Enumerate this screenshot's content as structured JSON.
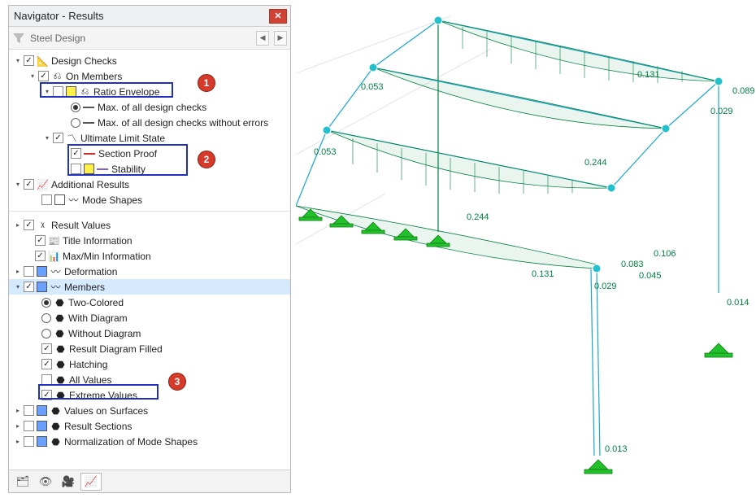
{
  "window": {
    "title": "Navigator - Results"
  },
  "subheader": {
    "label": "Steel Design"
  },
  "tree": {
    "design_checks": {
      "label": "Design Checks",
      "on_members": {
        "label": "On Members",
        "ratio_envelope": {
          "label": "Ratio Envelope",
          "swatch": "#fff04a",
          "max_all": "Max. of all design checks",
          "max_no_err": "Max. of all design checks without errors"
        },
        "uls": {
          "label": "Ultimate Limit State",
          "section_proof": {
            "label": "Section Proof",
            "color": "#d03030"
          },
          "stability": {
            "label": "Stability",
            "color": "#8860c8",
            "swatch": "#fff04a"
          }
        }
      },
      "additional_results": {
        "label": "Additional Results",
        "mode_shapes": "Mode Shapes"
      }
    },
    "result_values": {
      "label": "Result Values"
    },
    "title_info": {
      "label": "Title Information"
    },
    "maxmin_info": {
      "label": "Max/Min Information"
    },
    "deformation": {
      "label": "Deformation"
    },
    "members": {
      "label": "Members",
      "two_colored": "Two-Colored",
      "with_diagram": "With Diagram",
      "without_diagram": "Without Diagram",
      "diag_filled": "Result Diagram Filled",
      "hatching": "Hatching",
      "all_values": "All Values",
      "extreme_values": "Extreme Values"
    },
    "values_on_surfaces": {
      "label": "Values on Surfaces"
    },
    "result_sections": {
      "label": "Result Sections"
    },
    "norm_mode_shapes": {
      "label": "Normalization of Mode Shapes"
    }
  },
  "callouts": {
    "c1": "1",
    "c2": "2",
    "c3": "3"
  },
  "colors": {
    "swatch_yellow": "#fff04a",
    "swatch_blue": "#6aa0ff",
    "swatch_none": "#ffffff"
  },
  "ratio_values": [
    "0.053",
    "0.131",
    "0.089",
    "0.029",
    "0.053",
    "0.244",
    "0.244",
    "0.131",
    "0.106",
    "0.083",
    "0.045",
    "0.029",
    "0.014",
    "0.013"
  ]
}
